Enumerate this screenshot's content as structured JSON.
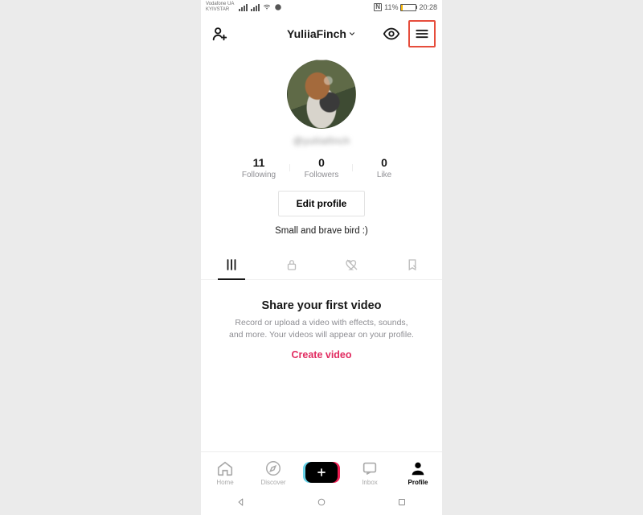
{
  "statusbar": {
    "carrier1": "Vodafone UA",
    "carrier2": "KYIVSTAR",
    "battery_percent": "11%",
    "time": "20:28"
  },
  "header": {
    "username": "YuliiaFinch"
  },
  "profile": {
    "handle": "@yuliiafinch",
    "stats": {
      "following": {
        "count": "11",
        "label": "Following"
      },
      "followers": {
        "count": "0",
        "label": "Followers"
      },
      "like": {
        "count": "0",
        "label": "Like"
      }
    },
    "edit_label": "Edit profile",
    "bio": "Small and brave bird :)"
  },
  "empty": {
    "title": "Share your first video",
    "line1": "Record or upload a video with effects, sounds,",
    "line2": "and more. Your videos will appear on your profile.",
    "create_label": "Create video"
  },
  "tabbar": {
    "home": "Home",
    "discover": "Discover",
    "inbox": "Inbox",
    "profile": "Profile"
  }
}
